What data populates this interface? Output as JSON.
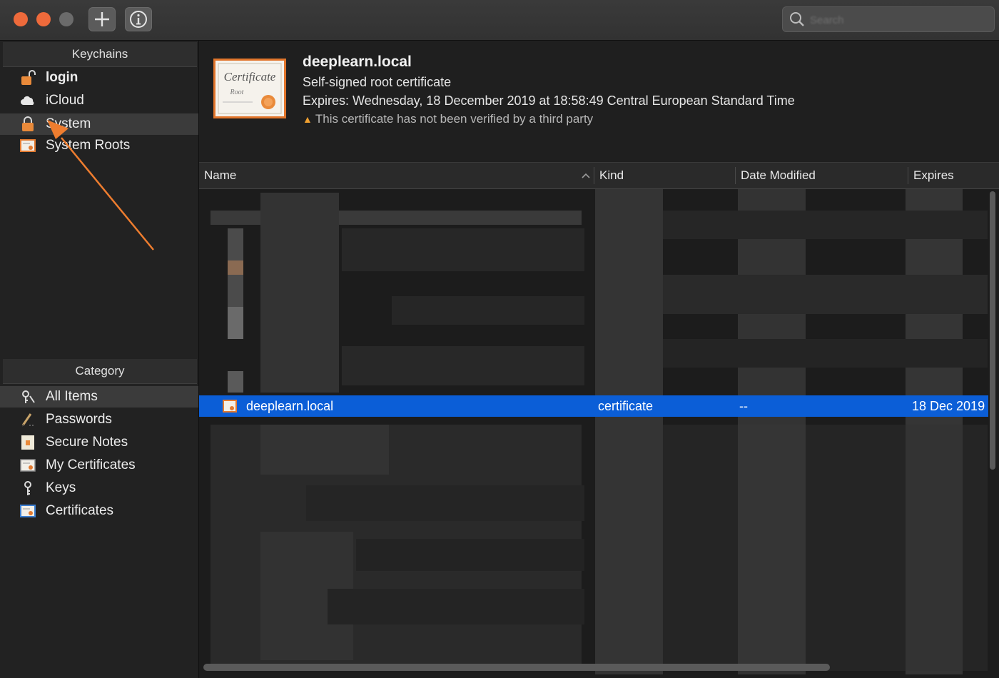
{
  "toolbar": {
    "window_controls": [
      "close",
      "minimize",
      "zoom"
    ],
    "add_icon": "plus-icon",
    "info_icon": "info-icon",
    "search_placeholder": "Search"
  },
  "sidebar": {
    "keychains_header": "Keychains",
    "keychains": [
      {
        "label": "login",
        "icon": "unlocked-padlock-icon",
        "bold": true
      },
      {
        "label": "iCloud",
        "icon": "cloud-icon"
      },
      {
        "label": "System",
        "icon": "locked-padlock-icon",
        "selected": true
      },
      {
        "label": "System Roots",
        "icon": "certificate-icon"
      }
    ],
    "category_header": "Category",
    "categories": [
      {
        "label": "All Items",
        "icon": "all-items-icon",
        "selected": true
      },
      {
        "label": "Passwords",
        "icon": "pencil-icon"
      },
      {
        "label": "Secure Notes",
        "icon": "note-icon"
      },
      {
        "label": "My Certificates",
        "icon": "my-certificate-icon"
      },
      {
        "label": "Keys",
        "icon": "key-icon"
      },
      {
        "label": "Certificates",
        "icon": "certificate-icon"
      }
    ]
  },
  "detail": {
    "image_title": "Certificate",
    "image_subtitle": "Root",
    "title": "deeplearn.local",
    "subtitle": "Self-signed root certificate",
    "expires": "Expires: Wednesday, 18 December 2019 at 18:58:49 Central European Standard Time",
    "warning": "This certificate has not been verified by a third party"
  },
  "table": {
    "columns": [
      "Name",
      "Kind",
      "Date Modified",
      "Expires"
    ],
    "sort_column": "Name",
    "selected_row": {
      "name": "deeplearn.local",
      "kind": "certificate",
      "date_modified": "--",
      "expires": "18 Dec 2019"
    }
  },
  "colors": {
    "accent_orange": "#ee6a3b",
    "selection_blue": "#0b5ed7",
    "annotation_arrow": "#ee7d2f"
  }
}
